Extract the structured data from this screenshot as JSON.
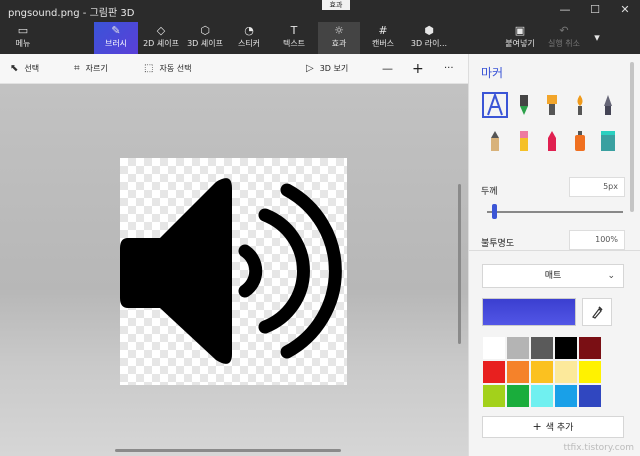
{
  "window": {
    "title": "pngsound.png - 그림판 3D",
    "tooltip": "효과",
    "controls": [
      "—",
      "☐",
      "✕"
    ]
  },
  "ribbon": {
    "menu": {
      "label": "메뉴",
      "icon": "folder-icon"
    },
    "tabs": [
      {
        "label": "브러시",
        "icon": "brush-icon"
      },
      {
        "label": "2D 셰이프",
        "icon": "2d-shapes-icon"
      },
      {
        "label": "3D 셰이프",
        "icon": "3d-shapes-icon"
      },
      {
        "label": "스티커",
        "icon": "sticker-icon"
      },
      {
        "label": "텍스트",
        "icon": "text-icon"
      },
      {
        "label": "효과",
        "icon": "effects-icon"
      },
      {
        "label": "캔버스",
        "icon": "canvas-icon"
      },
      {
        "label": "3D 라이...",
        "icon": "3d-library-icon"
      }
    ],
    "paste": {
      "label": "붙여넣기",
      "icon": "paste-icon"
    },
    "undo": {
      "label": "실행 취소",
      "icon": "undo-icon"
    },
    "more": {
      "icon": "chevron-down-icon"
    }
  },
  "toolbar": {
    "select": "선택",
    "crop": "자르기",
    "magic_select": "자동 선택",
    "view_3d": "3D 보기",
    "zoom_out": "—",
    "zoom_in": "+",
    "more": "···"
  },
  "panel": {
    "title": "마커",
    "brushes": [
      "marker",
      "calligraphy-pen",
      "oil-brush",
      "watercolor",
      "pixel-pen",
      "pencil",
      "eraser",
      "crayon",
      "spray-can",
      "fill"
    ],
    "thickness_label": "두께",
    "thickness_value": "5px",
    "thickness_level": 0.05,
    "opacity_label": "불투명도",
    "opacity_value": "100%",
    "finish": "매트",
    "current_color": "#3b3fd0",
    "palette": [
      "#ffffff",
      "#b4b4b4",
      "#5a5a5a",
      "#000000",
      "#7a0f14",
      "#e8201f",
      "#f5822a",
      "#fbc120",
      "#fce99b",
      "#fff200",
      "#a3d11b",
      "#1aad3c",
      "#70f0f0",
      "#19a0e8",
      "#3047c0"
    ],
    "add_color": "색 추가"
  },
  "watermark": "ttfix.tistory.com",
  "colors": {
    "accent": "#3b55d6",
    "titlebar": "#2b2b2b"
  }
}
